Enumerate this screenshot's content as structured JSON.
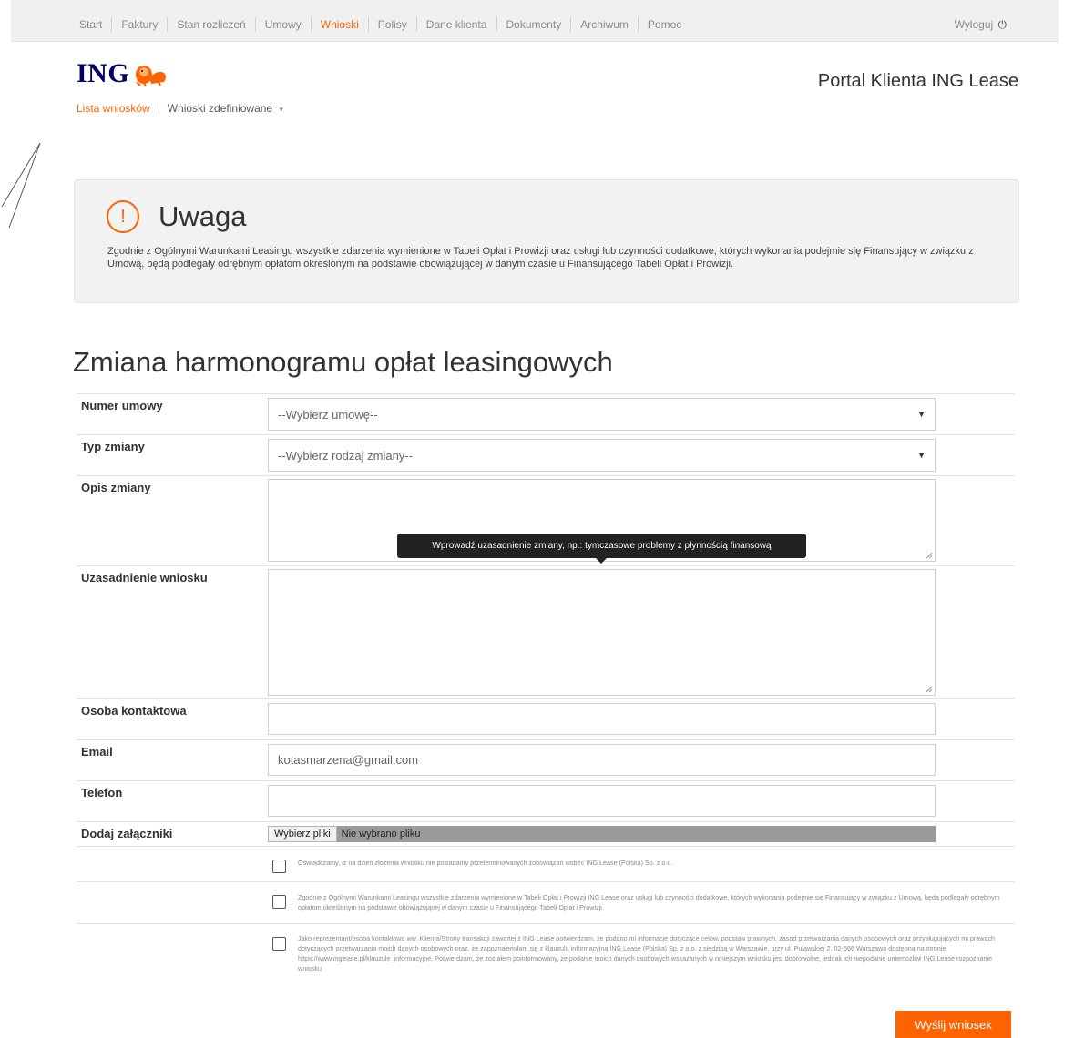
{
  "nav": {
    "items": [
      "Start",
      "Faktury",
      "Stan rozliczeń",
      "Umowy",
      "Wnioski",
      "Polisy",
      "Dane klienta",
      "Dokumenty",
      "Archiwum",
      "Pomoc"
    ],
    "active_index": 4,
    "logout_label": "Wyloguj",
    "logout_icon": "power-icon"
  },
  "header": {
    "logo_text": "ING",
    "logo_icon": "lion-logo-icon",
    "portal_title": "Portal Klienta ING Lease"
  },
  "subnav": {
    "active": "Lista wniosków",
    "defined": "Wnioski zdefiniowane"
  },
  "notice": {
    "icon": "exclamation-icon",
    "title": "Uwaga",
    "text": "Zgodnie z Ogólnymi Warunkami Leasingu wszystkie zdarzenia wymienione w Tabeli Opłat i Prowizji oraz usługi lub czynności dodatkowe, których wykonania podejmie się Finansujący w związku z Umową, będą podlegały odrębnym opłatom określonym na podstawie obowiązującej w danym czasie u Finansującego Tabeli Opłat i Prowizji."
  },
  "form": {
    "title": "Zmiana harmonogramu opłat leasingowych",
    "contract_label": "Numer umowy",
    "contract_value": "--Wybierz umowę--",
    "change_type_label": "Typ zmiany",
    "change_type_value": "--Wybierz rodzaj zmiany--",
    "description_label": "Opis zmiany",
    "justification_label": "Uzasadnienie wniosku",
    "tooltip": "Wprowadź uzasadnienie zmiany, np.: tymczasowe problemy z płynnością finansową",
    "contact_label": "Osoba kontaktowa",
    "contact_value": "",
    "email_label": "Email",
    "email_value": "kotasmarzena@gmail.com",
    "phone_label": "Telefon",
    "phone_value": "",
    "attachments_label": "Dodaj załączniki",
    "file_button": "Wybierz pliki",
    "file_status": "Nie wybrano pliku",
    "consents": [
      "Oświadczamy, iż na dzień złożenia wniosku nie posiadamy przeterminowanych zobowiązań wobec ING Lease (Polska) Sp. z o.o.",
      "Zgodnie z Ogólnymi Warunkami Leasingu wszystkie zdarzenia wymienione w Tabeli Opłat i Prowizji ING Lease oraz usługi lub czynności dodatkowe, których wykonania podejmie się Finansujący w związku z Umową, będą podlegały odrębnym opłatom określonym na podstawie obowiązującej w danym czasie u Finansującego Tabeli Opłat i Prowizji",
      "Jako reprezentant/osoba kontaktowa ww. Klienta/Strony transakcji zawartej z ING Lease potwierdzam, że podano mi informacje dotyczące celów, podstaw prawnych, zasad przetwarzania danych osobowych oraz przysługujących mi prawach dotyczących przetwarzania moich danych osobowych oraz, że zapoznałem/łam się z klauzulą informacyjną ING Lease (Polska) Sp. z o.o. z siedzibą w Warszawie, przy ul. Puławskiej 2, 02-566 Warszawa dostępną na stronie https://www.inglease.pl/klauzule_informacyjne. Potwierdzam, że zostałem poinformowany, że podanie moich danych osobowych wskazanych w niniejszym wniosku jest dobrowolne, jednak ich niepodanie uniemożliwi ING Lease rozpoznanie wniosku."
    ],
    "submit_label": "Wyślij wniosek"
  },
  "colors": {
    "accent": "#ff6200",
    "brand_navy": "#000066"
  }
}
